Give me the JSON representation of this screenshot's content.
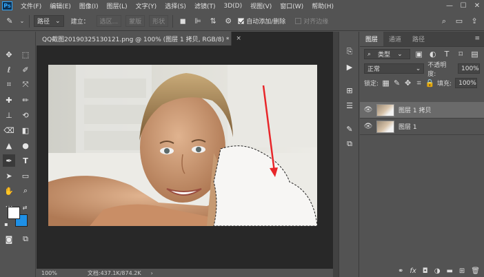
{
  "app": {
    "logo": "Ps"
  },
  "menu": [
    "文件(F)",
    "编辑(E)",
    "图像(I)",
    "图层(L)",
    "文字(Y)",
    "选择(S)",
    "滤镜(T)",
    "3D(D)",
    "视图(V)",
    "窗口(W)",
    "帮助(H)"
  ],
  "window_controls": [
    "—",
    "☐",
    "✕"
  ],
  "options": {
    "mode_select": "路径",
    "build": "建立：",
    "selection_btn": "选区...",
    "mask_btn": "蒙版",
    "shape_btn": "形状",
    "auto_add_delete": "自动添加/删除",
    "align_edges": "对齐边缘"
  },
  "document": {
    "tab_title": "QQ截图20190325130121.png @ 100% (图层 1 拷贝, RGB/8) *",
    "close": "×"
  },
  "status": {
    "zoom": "100%",
    "doc_info": "文档:437.1K/874.2K",
    "arrow": "›"
  },
  "panel": {
    "tabs": [
      "图层",
      "通道",
      "路径"
    ],
    "filter_label": "类型",
    "blend_mode": "正常",
    "opacity_label": "不透明度:",
    "opacity_value": "100%",
    "lock_label": "锁定:",
    "fill_label": "填充:",
    "fill_value": "100%",
    "layers": [
      {
        "name": "图层 1 拷贝",
        "selected": true
      },
      {
        "name": "图层 1",
        "selected": false
      }
    ]
  },
  "colors": {
    "foreground": "#ffffff",
    "background": "#1e90e6",
    "accent": "#31a8ff"
  }
}
